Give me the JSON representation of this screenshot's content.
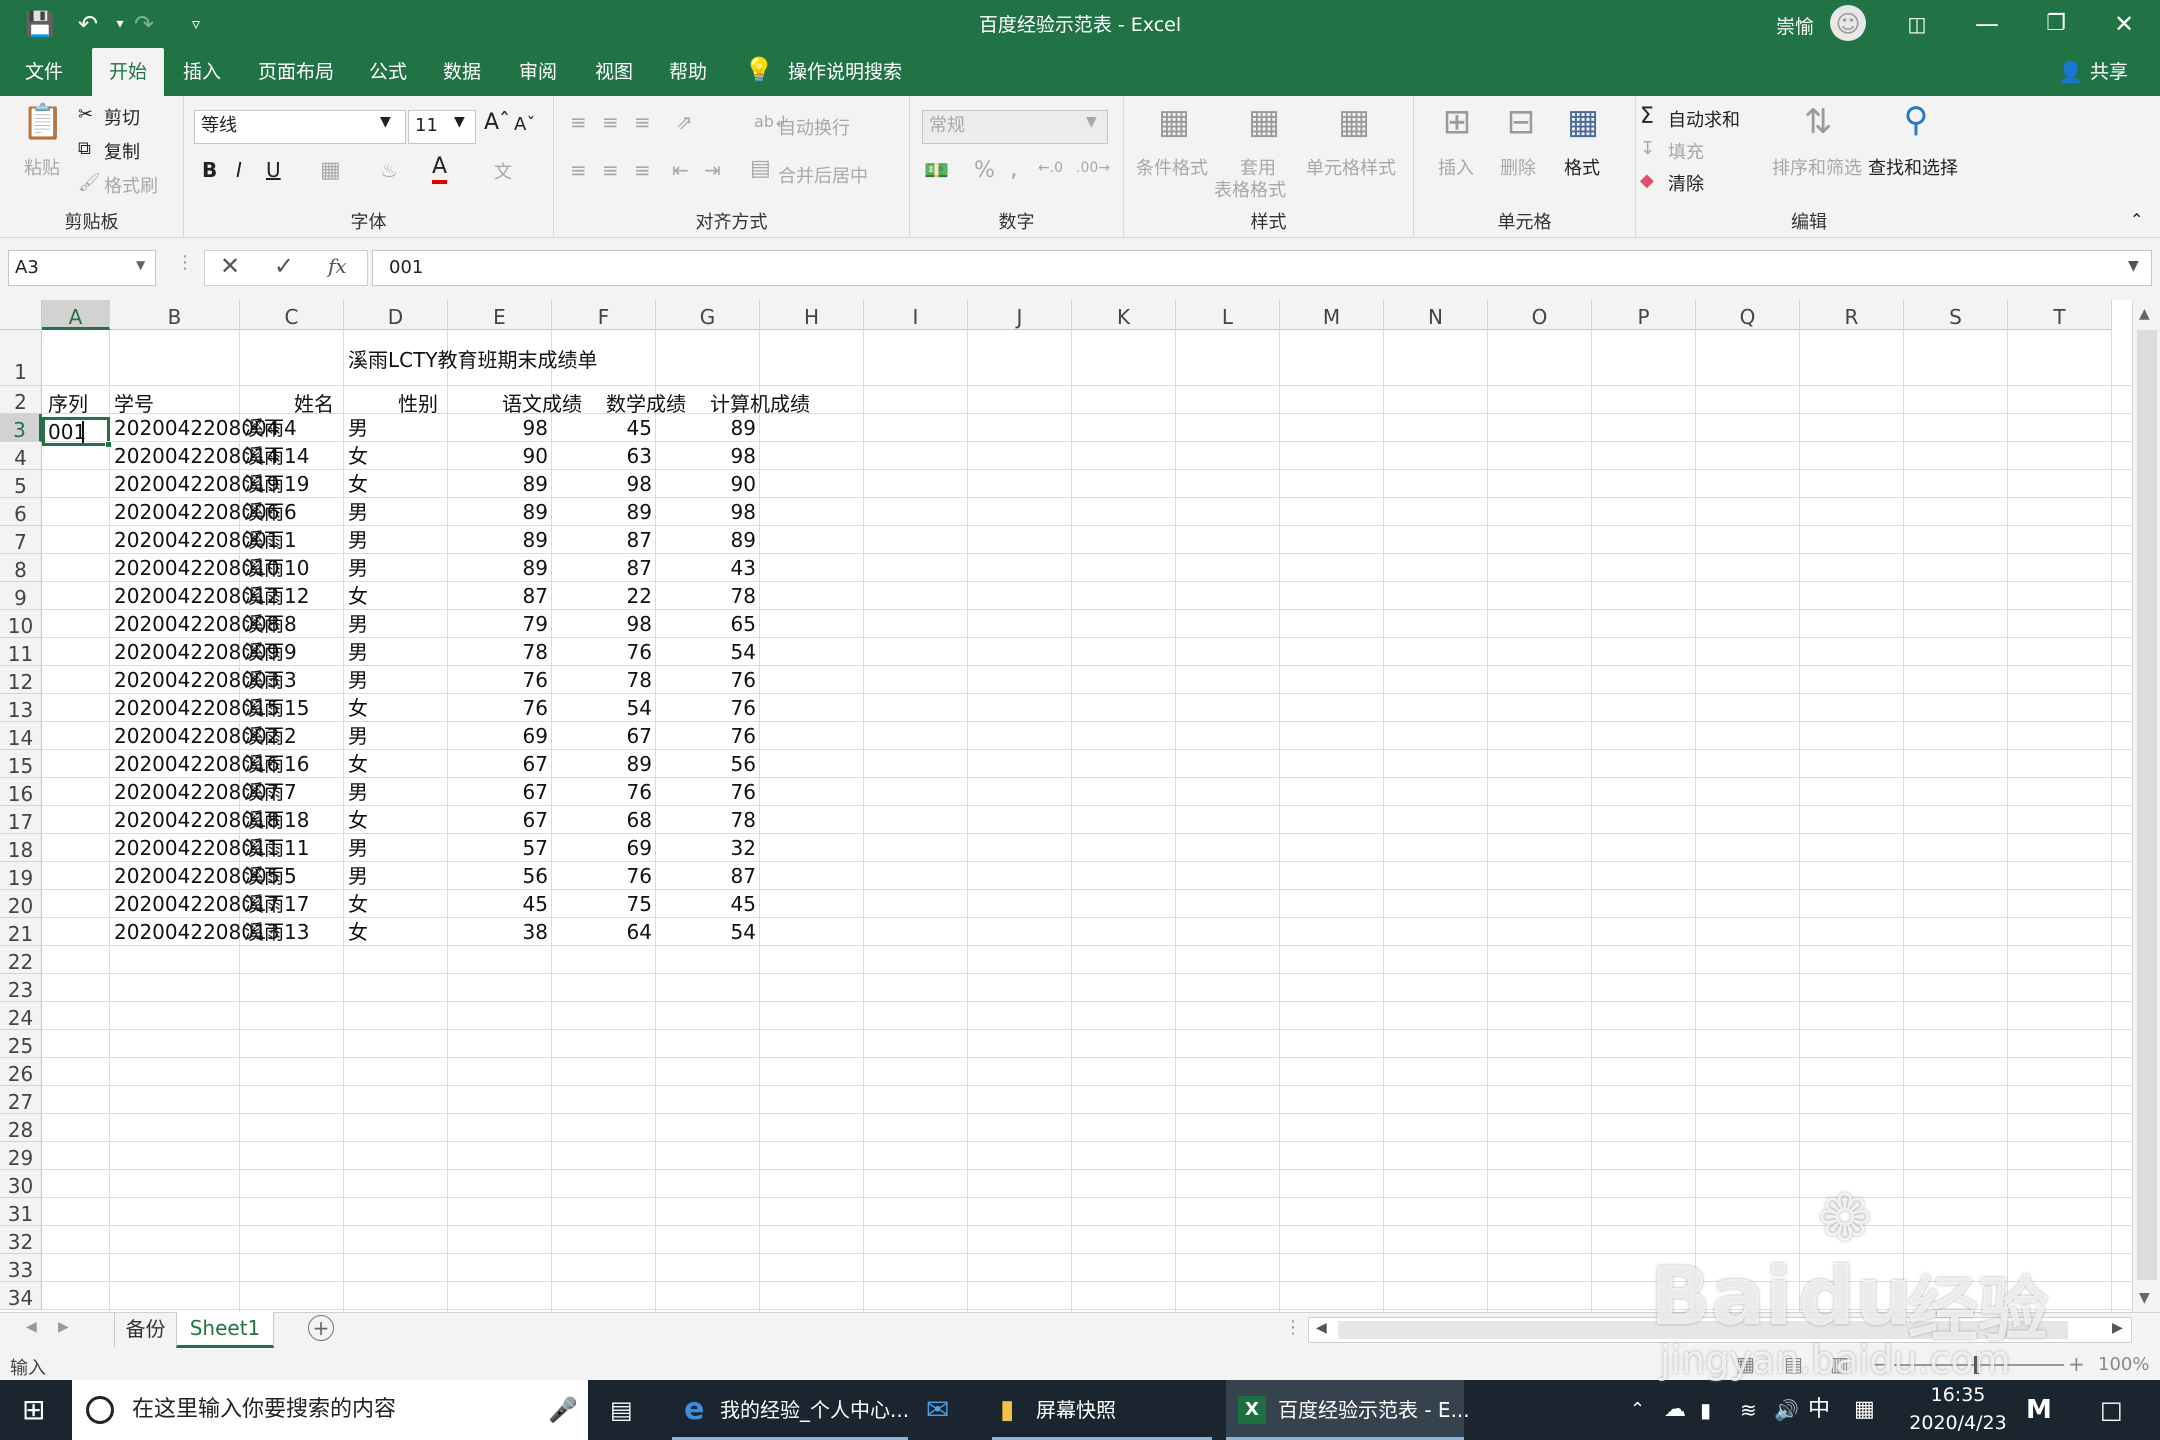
{
  "window": {
    "title": "百度经验示范表 - Excel",
    "user_name": "崇愉"
  },
  "quick_access": {
    "save_icon": "save-icon",
    "undo_icon": "undo-icon",
    "redo_icon": "redo-icon",
    "customize_icon": "customize-icon"
  },
  "ribbon_tabs": [
    "文件",
    "开始",
    "插入",
    "页面布局",
    "公式",
    "数据",
    "审阅",
    "视图",
    "帮助"
  ],
  "ribbon_search": "操作说明搜索",
  "share_label": "共享",
  "clipboard": {
    "paste": "粘贴",
    "cut": "剪切",
    "copy": "复制",
    "format_painter": "格式刷",
    "group": "剪贴板"
  },
  "font": {
    "name": "等线",
    "size": "11",
    "bold": "B",
    "italic": "I",
    "underline": "U",
    "group": "字体"
  },
  "alignment": {
    "wrap": "自动换行",
    "merge": "合并后居中",
    "group": "对齐方式"
  },
  "number": {
    "format": "常规",
    "percent": "%",
    "comma": ",",
    "group": "数字"
  },
  "styles": {
    "conditional": "条件格式",
    "table_line1": "套用",
    "table_line2": "表格格式",
    "cell_styles": "单元格样式",
    "group": "样式"
  },
  "cells": {
    "insert": "插入",
    "delete": "删除",
    "format": "格式",
    "group": "单元格"
  },
  "editing": {
    "autosum": "自动求和",
    "fill": "填充",
    "clear": "清除",
    "sort": "排序和筛选",
    "find": "查找和选择",
    "group": "编辑"
  },
  "formula_bar": {
    "name_box": "A3",
    "fx": "fx",
    "value": "001"
  },
  "columns": [
    "A",
    "B",
    "C",
    "D",
    "E",
    "F",
    "G",
    "H",
    "I",
    "J",
    "K",
    "L",
    "M",
    "N",
    "O",
    "P",
    "Q",
    "R",
    "S",
    "T"
  ],
  "row_numbers": [
    "1",
    "2",
    "3",
    "4",
    "5",
    "6",
    "7",
    "8",
    "9",
    "10",
    "11",
    "12",
    "13",
    "14",
    "15",
    "16",
    "17",
    "18",
    "19",
    "20",
    "21",
    "22",
    "23",
    "24",
    "25",
    "26",
    "27",
    "28",
    "29",
    "30",
    "31",
    "32",
    "33",
    "34"
  ],
  "sheet": {
    "title": "溪雨LCTY教育班期末成绩单",
    "headers": [
      "序列",
      "学号",
      "姓名",
      "性别",
      "语文成绩",
      "数学成绩",
      "计算机成绩"
    ],
    "active_cell_value": "001",
    "rows": [
      [
        "2020042208004",
        "溪雨4",
        "男",
        "98",
        "45",
        "89"
      ],
      [
        "2020042208014",
        "溪雨14",
        "女",
        "90",
        "63",
        "98"
      ],
      [
        "2020042208019",
        "溪雨19",
        "女",
        "89",
        "98",
        "90"
      ],
      [
        "2020042208006",
        "溪雨6",
        "男",
        "89",
        "89",
        "98"
      ],
      [
        "2020042208001",
        "溪雨1",
        "男",
        "89",
        "87",
        "89"
      ],
      [
        "2020042208010",
        "溪雨10",
        "男",
        "89",
        "87",
        "43"
      ],
      [
        "2020042208012",
        "溪雨12",
        "女",
        "87",
        "22",
        "78"
      ],
      [
        "2020042208008",
        "溪雨8",
        "男",
        "79",
        "98",
        "65"
      ],
      [
        "2020042208009",
        "溪雨9",
        "男",
        "78",
        "76",
        "54"
      ],
      [
        "2020042208003",
        "溪雨3",
        "男",
        "76",
        "78",
        "76"
      ],
      [
        "2020042208015",
        "溪雨15",
        "女",
        "76",
        "54",
        "76"
      ],
      [
        "2020042208002",
        "溪雨2",
        "男",
        "69",
        "67",
        "76"
      ],
      [
        "2020042208016",
        "溪雨16",
        "女",
        "67",
        "89",
        "56"
      ],
      [
        "2020042208007",
        "溪雨7",
        "男",
        "67",
        "76",
        "76"
      ],
      [
        "2020042208018",
        "溪雨18",
        "女",
        "67",
        "68",
        "78"
      ],
      [
        "2020042208011",
        "溪雨11",
        "男",
        "57",
        "69",
        "32"
      ],
      [
        "2020042208005",
        "溪雨5",
        "男",
        "56",
        "76",
        "87"
      ],
      [
        "2020042208017",
        "溪雨17",
        "女",
        "45",
        "75",
        "45"
      ],
      [
        "2020042208013",
        "溪雨13",
        "女",
        "38",
        "64",
        "54"
      ]
    ]
  },
  "sheet_tabs": [
    "备份",
    "Sheet1"
  ],
  "active_sheet": "Sheet1",
  "status": {
    "mode": "输入",
    "zoom": "100%"
  },
  "taskbar": {
    "search_placeholder": "在这里输入你要搜索的内容",
    "app_edge": "我的经验_个人中心...",
    "app_folder": "屏幕快照",
    "app_excel": "百度经验示范表 - E...",
    "ime": "中",
    "time": "16:35",
    "date": "2020/4/23"
  },
  "watermark": {
    "brand": "Bai",
    "brand2": "du",
    "cn": "经验",
    "url": "jingyan.baidu.com"
  },
  "colors": {
    "excel_green": "#217346",
    "selection_green": "#217346",
    "taskbar": "#1b2530"
  }
}
